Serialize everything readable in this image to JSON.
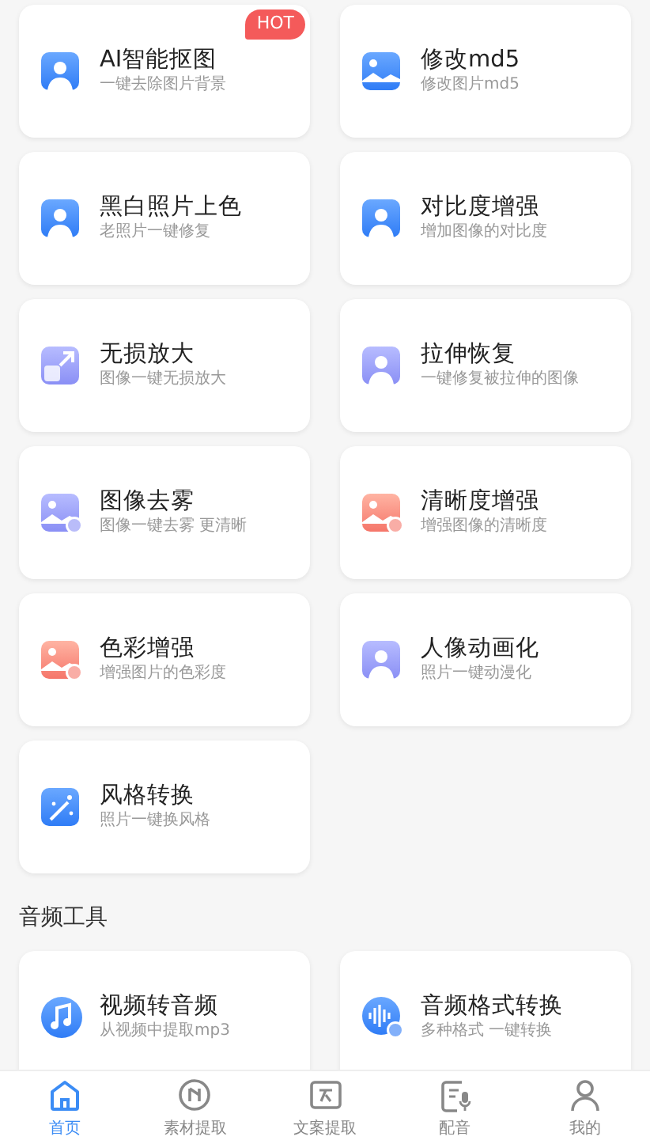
{
  "image_tools": [
    {
      "title": "AI智能抠图",
      "subtitle": "一键去除图片背景",
      "badge": "HOT"
    },
    {
      "title": "修改md5",
      "subtitle": "修改图片md5"
    },
    {
      "title": "黑白照片上色",
      "subtitle": "老照片一键修复"
    },
    {
      "title": "对比度增强",
      "subtitle": "增加图像的对比度"
    },
    {
      "title": "无损放大",
      "subtitle": "图像一键无损放大"
    },
    {
      "title": "拉伸恢复",
      "subtitle": "一键修复被拉伸的图像"
    },
    {
      "title": "图像去雾",
      "subtitle": "图像一键去雾 更清晰"
    },
    {
      "title": "清晰度增强",
      "subtitle": "增强图像的清晰度"
    },
    {
      "title": "色彩增强",
      "subtitle": "增强图片的色彩度"
    },
    {
      "title": "人像动画化",
      "subtitle": "照片一键动漫化"
    },
    {
      "title": "风格转换",
      "subtitle": "照片一键换风格"
    }
  ],
  "audio_section": {
    "title": "音频工具",
    "tools": [
      {
        "title": "视频转音频",
        "subtitle": "从视频中提取mp3"
      },
      {
        "title": "音频格式转换",
        "subtitle": "多种格式 一键转换"
      }
    ]
  },
  "tab_bar": [
    {
      "label": "首页",
      "selected": true
    },
    {
      "label": "素材提取",
      "selected": false
    },
    {
      "label": "文案提取",
      "selected": false
    },
    {
      "label": "配音",
      "selected": false
    },
    {
      "label": "我的",
      "selected": false
    }
  ]
}
